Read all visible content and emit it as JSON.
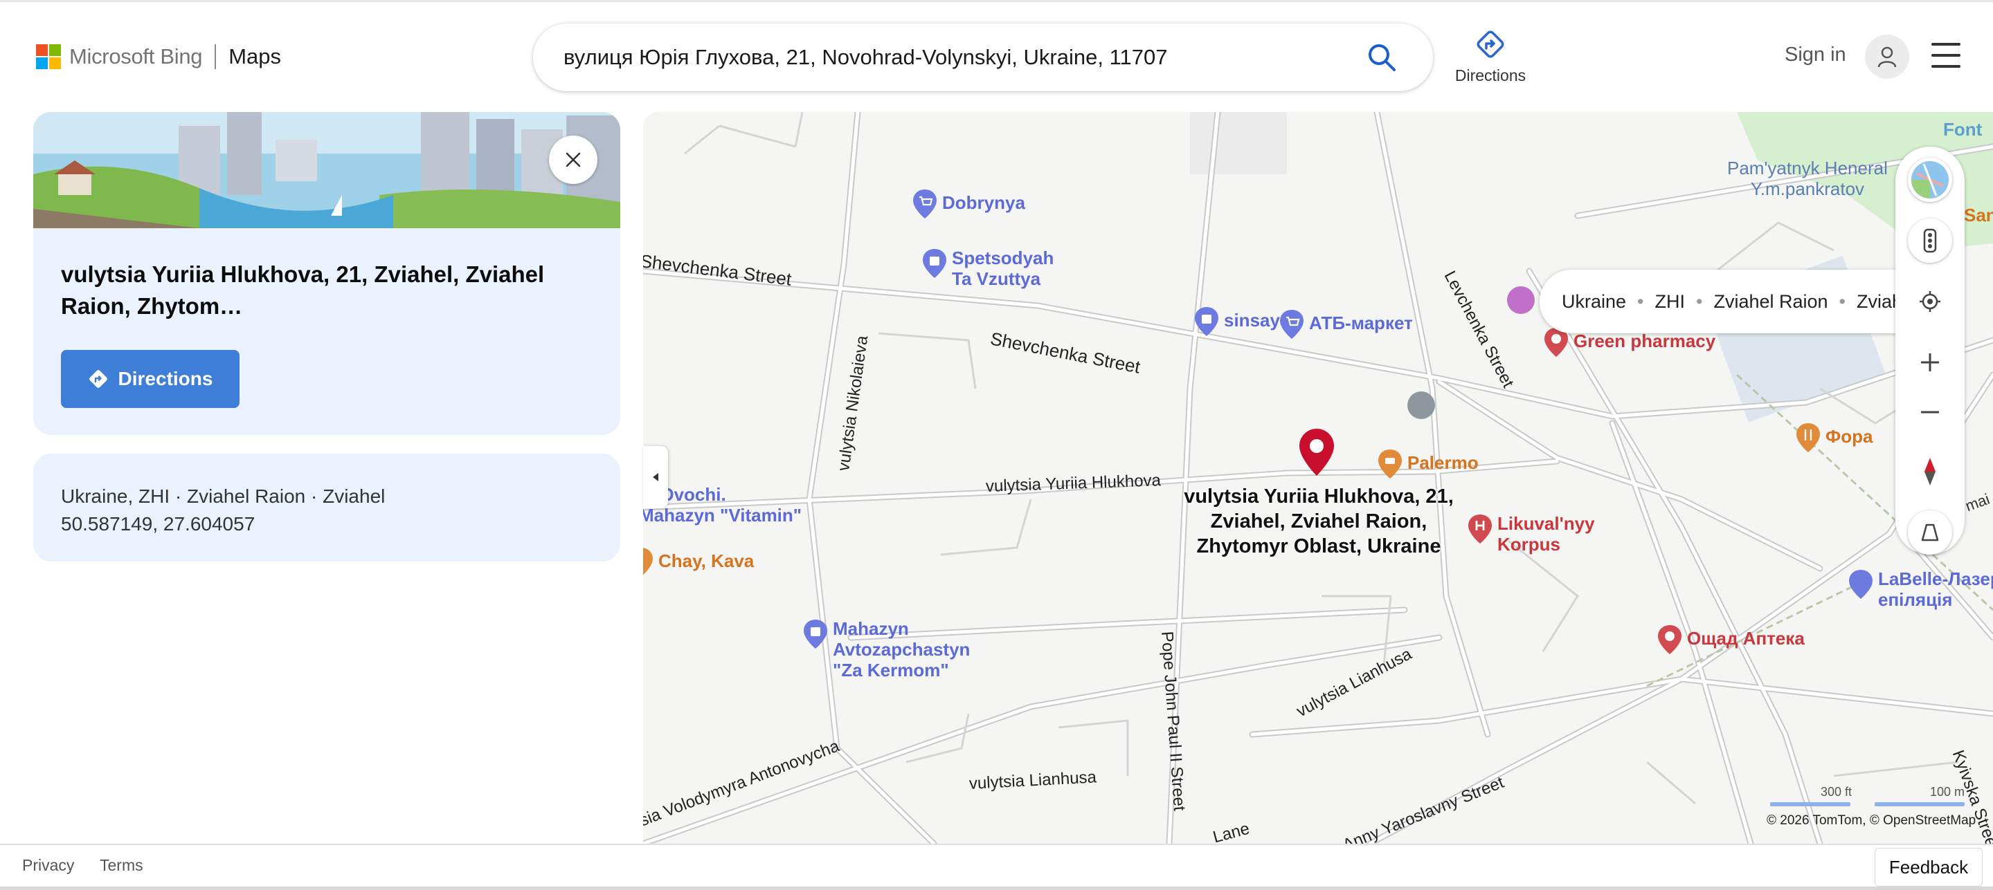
{
  "header": {
    "brand": "Microsoft Bing",
    "product": "Maps",
    "search_value": "вулиця Юрія Глухова, 21, Novohrad-Volynskyi, Ukraine, 11707",
    "directions_label": "Directions",
    "signin_label": "Sign in"
  },
  "place": {
    "title": "vulytsia Yuriia Hlukhova, 21, Zviahel, Zviahel Raion, Zhytom…",
    "directions_button": "Directions",
    "region_line": "Ukraine, ZHI · Zviahel Raion · Zviahel",
    "coordinates": "50.587149, 27.604057"
  },
  "map": {
    "breadcrumb": [
      "Ukraine",
      "ZHI",
      "Zviahel Raion",
      "Zviahel"
    ],
    "pin_label": "vulytsia Yuriia Hlukhova, 21, Zviahel, Zviahel Raion, Zhytomyr Oblast, Ukraine",
    "streets": {
      "shevchenko_left": "Shevchenka Street",
      "shevchenko_mid": "Shevchenka Street",
      "nikolaieva": "vulytsia Nikolaieva",
      "hlukhova": "vulytsia Yuriia Hlukhova",
      "levchenka": "Levchenka Street",
      "pope": "Pope John Paul II Street",
      "lianhusa_right": "vulytsia Lianhusa",
      "lianhusa_bottom": "vulytsia Lianhusa",
      "antonovycha": "vulytsia Volodymyra Antonovycha",
      "yaroslavny": "Anny Yaroslavny Street",
      "lane": "Lane",
      "kyivska": "Kyivska Street"
    },
    "pois": {
      "dobrynya": "Dobrynya",
      "spetsodyah_1": "Spetsodyah",
      "spetsodyah_2": "Ta Vzuttya",
      "sinsay": "sinsay",
      "atb": "АТБ-маркет",
      "green_pharmacy": "Green pharmacy",
      "palermo": "Palermo",
      "fora": "Фора",
      "ovochi_1": "ty Ovochi.",
      "ovochi_2": "Mahazyn \"Vitamin\"",
      "chay_kava": "Chay, Kava",
      "likuvalnyy_1": "Likuval'nyy",
      "likuvalnyy_2": "Korpus",
      "avtozap_1": "Mahazyn",
      "avtozap_2": "Avtozapchastyn",
      "avtozap_3": "\"Za Kermom\"",
      "oschad": "Ощад Аптека",
      "labelle_1": "LaBelle-Лазер",
      "labelle_2": "епіляція",
      "pamyatnyk_1": "Pam'yatnyk Heneral",
      "pamyatnyk_2": "Y.m.pankratov",
      "font": "Font",
      "san": "San",
      "small_right": "mai"
    },
    "scale_ft": "300 ft",
    "scale_m": "100 m",
    "copyright": "© 2026 TomTom, © OpenStreetMap"
  },
  "footer": {
    "privacy": "Privacy",
    "terms": "Terms",
    "feedback": "Feedback"
  },
  "colors": {
    "accent": "#3f7ed6",
    "panel_bg": "#eaf3fd",
    "pin_red": "#c8102e",
    "poi_blue": "#5b6ad6",
    "poi_orange": "#d5731f",
    "poi_red": "#c8373d"
  }
}
